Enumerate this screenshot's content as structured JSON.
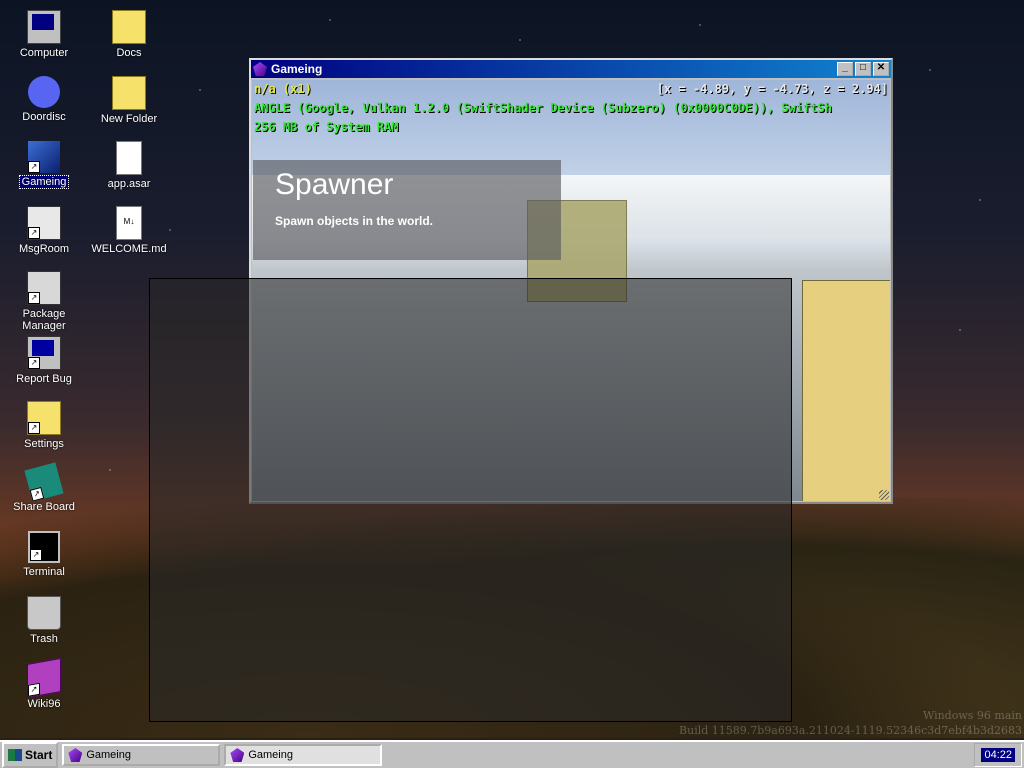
{
  "desktop": {
    "icons": [
      {
        "label": "Computer"
      },
      {
        "label": "Doordisc"
      },
      {
        "label": "Gameing"
      },
      {
        "label": "MsgRoom"
      },
      {
        "label": "Package Manager"
      },
      {
        "label": "Report Bug"
      },
      {
        "label": "Settings"
      },
      {
        "label": "Share Board"
      },
      {
        "label": "Terminal"
      },
      {
        "label": "Trash"
      },
      {
        "label": "Wiki96"
      },
      {
        "label": "Docs"
      },
      {
        "label": "New Folder"
      },
      {
        "label": "app.asar"
      },
      {
        "label": "WELCOME.md"
      }
    ],
    "watermark_line1": "Windows 96 main",
    "watermark_line2": "Build 11589.7b9a693a.211024-1119.52346c3d7ebf4b3d2683"
  },
  "window": {
    "title": "Gameing",
    "hud": {
      "line1": "n/a (x1)",
      "coords": "[x = -4.89, y = -4.73, z = 2.94]",
      "line2": "ANGLE (Google, Vulkan 1.2.0 (SwiftShader Device (Subzero) (0x0000C0DE)), SwiftSh",
      "line3": "256 MB of System RAM"
    },
    "panel": {
      "title": "Spawner",
      "subtitle": "Spawn objects in the world."
    }
  },
  "taskbar": {
    "start_label": "Start",
    "tasks": [
      {
        "label": "Gameing"
      },
      {
        "label": "Gameing"
      }
    ],
    "clock": "04:22"
  }
}
